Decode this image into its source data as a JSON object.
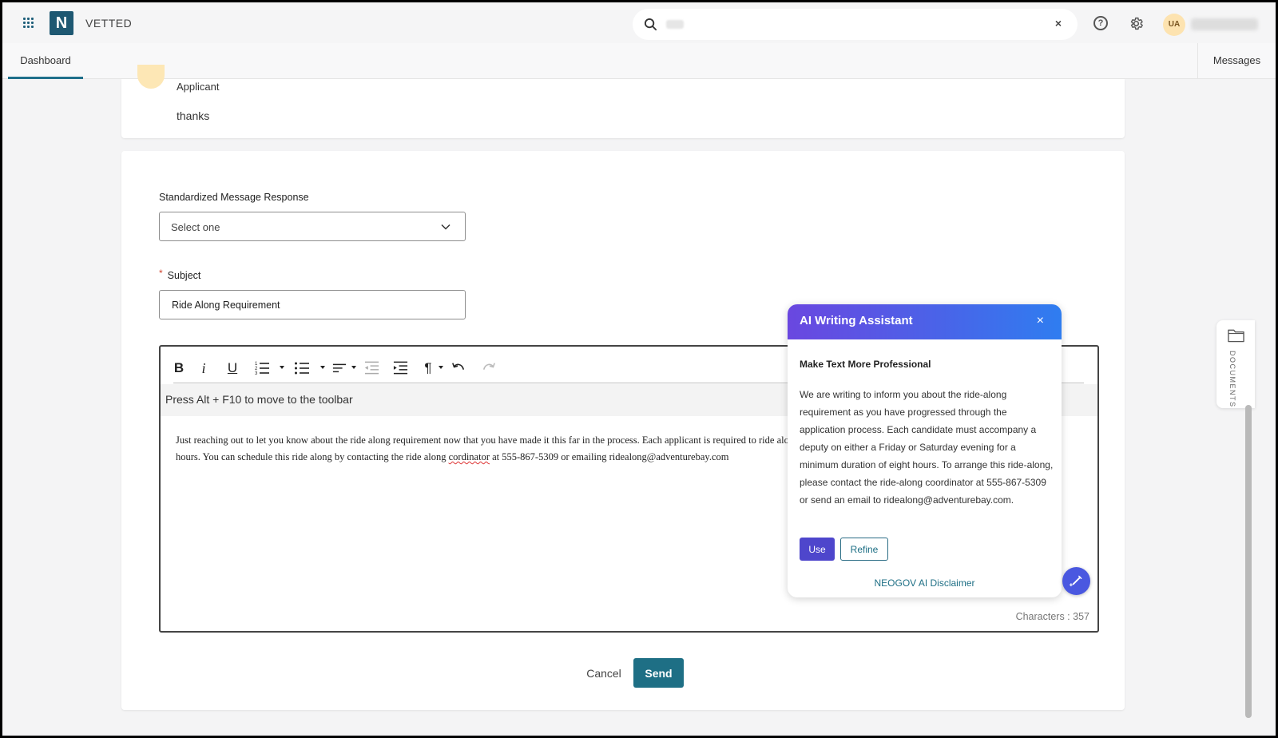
{
  "app": {
    "logo_letter": "N",
    "name": "VETTED"
  },
  "header": {
    "search_placeholder": "",
    "clear_label": "×",
    "avatar_initials": "UA"
  },
  "nav": {
    "tabs": [
      {
        "label": "Dashboard",
        "active": true
      },
      {
        "label": "Messages",
        "active": false
      }
    ]
  },
  "previous_message": {
    "role": "Applicant",
    "text": "thanks"
  },
  "form": {
    "std_response_label": "Standardized Message Response",
    "std_response_value": "Select one",
    "subject_required_mark": "*",
    "subject_label": "Subject",
    "subject_value": "Ride Along Requirement"
  },
  "editor": {
    "toolbar": [
      "bold",
      "italic",
      "underline",
      "numbered-list",
      "bulleted-list",
      "align",
      "outdent",
      "indent",
      "paragraph",
      "undo",
      "redo"
    ],
    "hint": "Press Alt + F10 to move to the toolbar",
    "body_part1": "Just reaching out to let you know about the ride along requirement now that you have made it this far in the process. Each applicant is required to ride along with a deputy on a Friday or Saturday night for a minimum of 8 hours.  You can schedule this ride along by contacting the ride along ",
    "body_misspelled": "cordinator",
    "body_part2": " at 555-867-5309 or emailing ridealong@adventurebay.com",
    "char_count": "Characters : 357"
  },
  "actions": {
    "cancel": "Cancel",
    "send": "Send"
  },
  "ai_assistant": {
    "title": "AI Writing Assistant",
    "close": "×",
    "heading": "Make Text More Professional",
    "suggestion": "We are writing to inform you about the ride-along requirement as you have progressed through the application process. Each candidate must accompany a deputy on either a Friday or Saturday evening for a minimum duration of eight hours. To arrange this ride-along, please contact the ride-along coordinator at 555-867-5309 or send an email to ridealong@adventurebay.com.",
    "use_label": "Use",
    "refine_label": "Refine",
    "disclaimer": "NEOGOV AI Disclaimer"
  },
  "side_tab": {
    "label": "DOCUMENTS"
  },
  "colors": {
    "brand": "#1e6f85",
    "ai_gradient_start": "#6a47e0",
    "ai_gradient_end": "#2f7df0",
    "use_button": "#4e46cc"
  }
}
